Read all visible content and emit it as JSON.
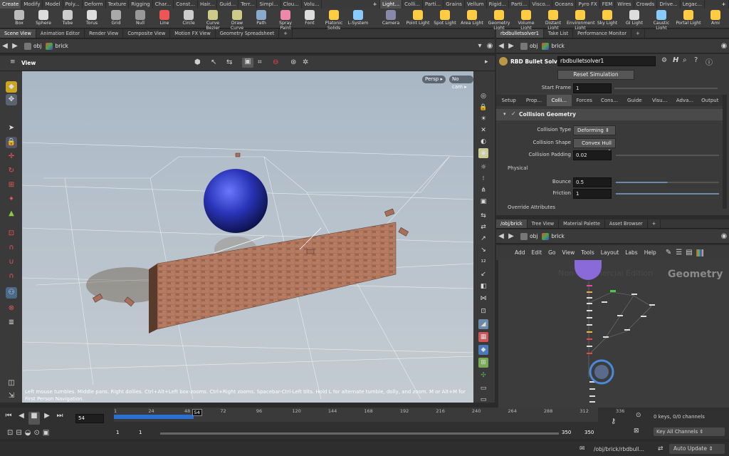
{
  "shelf_tabs_left": [
    "Create",
    "Modify",
    "Model",
    "Poly...",
    "Deform",
    "Texture",
    "Rigging",
    "Char...",
    "Const...",
    "Hair...",
    "Guid...",
    "Terr...",
    "Simpl...",
    "Clou...",
    "Volu..."
  ],
  "shelf_tabs_right": [
    "Light...",
    "Colli...",
    "Parti...",
    "Grains",
    "Vellum",
    "Rigid...",
    "Parti...",
    "Visco...",
    "Oceans",
    "Pyro FX",
    "FEM",
    "Wires",
    "Crowds",
    "Drive...",
    "Legac..."
  ],
  "shelf_tools_left": [
    "Box",
    "Sphere",
    "Tube",
    "Torus",
    "Grid",
    "Null",
    "Line",
    "Circle",
    "Curve Bezier",
    "Draw Curve",
    "Path",
    "Spray Paint",
    "Font",
    "Platonic Solids",
    "L-System"
  ],
  "shelf_tools_right": [
    "Camera",
    "Point Light",
    "Spot Light",
    "Area Light",
    "Geometry Light",
    "Volume Light",
    "Distant Light",
    "Environment Light",
    "Sky Light",
    "GI Light",
    "Caustic Light",
    "Portal Light",
    "Ami"
  ],
  "left_pane_tabs": [
    "Scene View",
    "Animation Editor",
    "Render View",
    "Composite View",
    "Motion FX View",
    "Geometry Spreadsheet"
  ],
  "right_top_tabs": [
    "rbdbulletsolver1",
    "Take List",
    "Performance Monitor"
  ],
  "right_bottom_tabs": [
    "/obj/brick",
    "Tree View",
    "Material Palette",
    "Asset Browser"
  ],
  "path": {
    "context": "obj",
    "node": "brick"
  },
  "viewport": {
    "label": "View",
    "persp": "Persp",
    "cam": "No cam",
    "status": "Left mouse tumbles. Middle pans. Right dollies. Ctrl+Alt+Left box-zooms. Ctrl+Right zooms. Spacebar-Ctrl-Left tilts. Hold L for alternate tumble, dolly, and zoom.     M or Alt+M for First Person Navigation."
  },
  "solver": {
    "type": "RBD Bullet Solver",
    "name": "rbdbulletsolver1",
    "reset": "Reset Simulation",
    "start_frame_label": "Start Frame",
    "start_frame": "1",
    "tabs": [
      "Setup",
      "Prop...",
      "Colli...",
      "Forces",
      "Cons...",
      "Guide",
      "Visu...",
      "Adva...",
      "Output"
    ],
    "section": "Collision Geometry",
    "collision_type_label": "Collision Type",
    "collision_type": "Deforming",
    "collision_shape_label": "Collision Shape",
    "collision_shape": "Convex Hull",
    "collision_padding_label": "Collision Padding",
    "collision_padding": "0.02",
    "physical": "Physical",
    "bounce_label": "Bounce",
    "bounce": "0.5",
    "friction_label": "Friction",
    "friction": "1",
    "override": "Override Attributes"
  },
  "net_menu": [
    "Add",
    "Edit",
    "Go",
    "View",
    "Tools",
    "Layout",
    "Labs",
    "Help"
  ],
  "net": {
    "watermark": "Non-Commercial Edition",
    "context_label": "Geometry"
  },
  "timeline": {
    "ticks": [
      "1",
      "24",
      "48",
      "72",
      "96",
      "120",
      "144",
      "168",
      "192",
      "216",
      "240",
      "264",
      "288",
      "312",
      "336"
    ],
    "current": "54",
    "frame_box": "54",
    "start": "1",
    "start2": "1",
    "end": "350",
    "end2": "350",
    "keys": "0 keys, 0/0 channels",
    "key_all": "Key All Channels",
    "progress_frame": 54,
    "range_end": 350
  },
  "status": {
    "path": "/obj/brick/rbdbull...",
    "update": "Auto Update"
  },
  "colors": {
    "accent": "#f0a030",
    "sphere": "#2a34b8",
    "brick": "#a8705a",
    "timebar": "#2a70d0"
  }
}
